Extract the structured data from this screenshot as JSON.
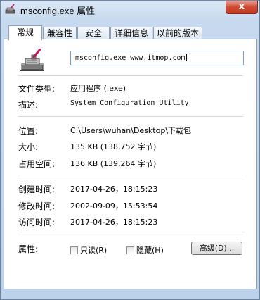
{
  "window": {
    "title": "msconfig.exe 属性",
    "close_label": "x"
  },
  "tabs": [
    {
      "label": "常规"
    },
    {
      "label": "兼容性"
    },
    {
      "label": "安全"
    },
    {
      "label": "详细信息"
    },
    {
      "label": "以前的版本"
    }
  ],
  "general": {
    "file_name": "msconfig.exe www.itmop.com",
    "rows": [
      {
        "label": "文件类型:",
        "value": "应用程序 (.exe)"
      },
      {
        "label": "描述:",
        "value": "System Configuration Utility"
      },
      {
        "label": "位置:",
        "value": "C:\\Users\\wuhan\\Desktop\\下载包"
      },
      {
        "label": "大小:",
        "value": "135 KB (138,752 字节)"
      },
      {
        "label": "占用空间:",
        "value": "136 KB (139,264 字节)"
      },
      {
        "label": "创建时间:",
        "value": "2017-04-26，18:15:23"
      },
      {
        "label": "修改时间:",
        "value": "2002-09-09，15:53:54"
      },
      {
        "label": "访问时间:",
        "value": "2017-04-26，18:15:23"
      }
    ],
    "attributes": {
      "label": "属性:",
      "readonly": {
        "label": "只读(R)",
        "checked": false
      },
      "hidden": {
        "label": "隐藏(H)",
        "checked": false
      },
      "advanced_label": "高级(D)..."
    }
  },
  "colors": {
    "close": "#c23a22",
    "tab_border": "#8e9fb4",
    "window_frame": "#c6d9ee"
  },
  "icons": {
    "title": "msconfig-app-icon",
    "file": "msconfig-app-icon"
  }
}
